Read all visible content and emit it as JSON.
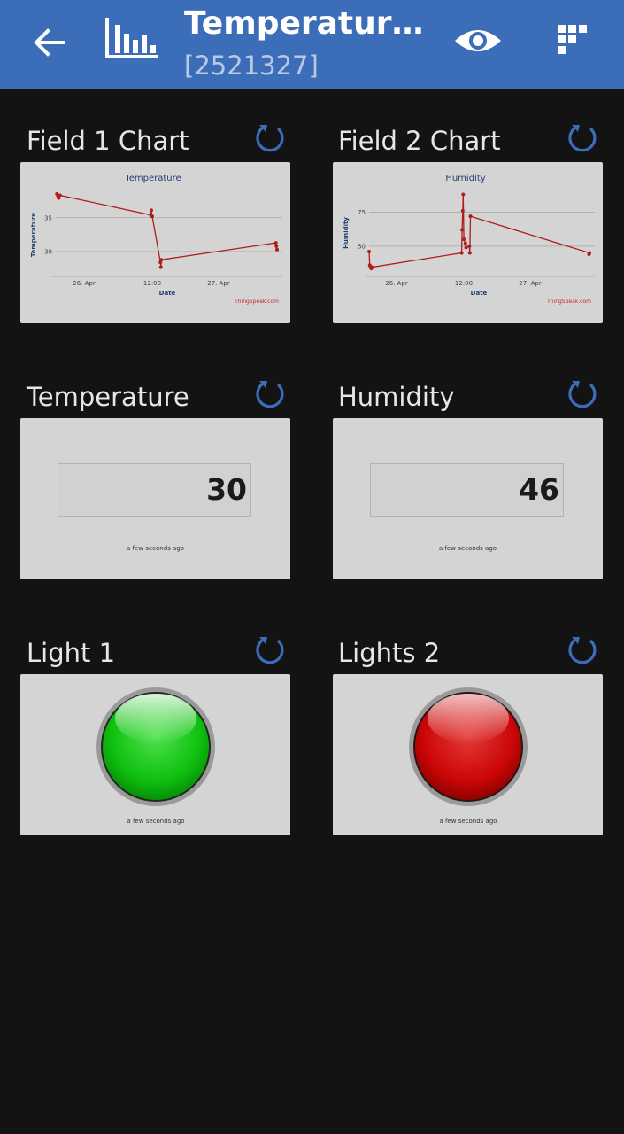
{
  "appbar": {
    "title": "Temperature…",
    "subtitle": "[2521327]",
    "back_icon": "arrow-left-icon",
    "charts_icon": "bar-chart-icon",
    "view_icon": "eye-icon",
    "menu_icon": "grid-icon",
    "background": "#3c6db8"
  },
  "cards": {
    "field1": {
      "title": "Field 1 Chart",
      "chart_data": {
        "type": "line",
        "title": "Temperature",
        "xlabel": "Date",
        "ylabel": "Temperature",
        "x_ticks": [
          "26. Apr",
          "12:00",
          "27. Apr"
        ],
        "y_ticks": [
          30,
          35
        ],
        "ylim": [
          27,
          38.5
        ],
        "series": [
          {
            "color": "#b01c1c",
            "points": [
              {
                "x": 0.005,
                "y": 38.5
              },
              {
                "x": 0.01,
                "y": 38.2
              },
              {
                "x": 0.013,
                "y": 37.9
              },
              {
                "x": 0.019,
                "y": 38.3
              },
              {
                "x": 0.43,
                "y": 35.4
              },
              {
                "x": 0.432,
                "y": 36.1
              },
              {
                "x": 0.436,
                "y": 35.2
              },
              {
                "x": 0.473,
                "y": 28.4
              },
              {
                "x": 0.475,
                "y": 27.7
              },
              {
                "x": 0.477,
                "y": 28.8
              },
              {
                "x": 0.995,
                "y": 31.3
              },
              {
                "x": 0.997,
                "y": 30.8
              },
              {
                "x": 1.0,
                "y": 30.3
              }
            ]
          }
        ],
        "watermark": "ThingSpeak.com",
        "grid": true
      },
      "refresh_icon": "refresh-icon"
    },
    "field2": {
      "title": "Field 2 Chart",
      "chart_data": {
        "type": "line",
        "title": "Humidity",
        "xlabel": "Date",
        "ylabel": "Humidity",
        "x_ticks": [
          "26. Apr",
          "12:00",
          "27. Apr"
        ],
        "y_ticks": [
          50,
          75
        ],
        "ylim": [
          31,
          89
        ],
        "series": [
          {
            "color": "#b01c1c",
            "points": [
              {
                "x": 0.0,
                "y": 46
              },
              {
                "x": 0.003,
                "y": 36
              },
              {
                "x": 0.006,
                "y": 35
              },
              {
                "x": 0.01,
                "y": 33.5
              },
              {
                "x": 0.013,
                "y": 34.5
              },
              {
                "x": 0.42,
                "y": 45
              },
              {
                "x": 0.422,
                "y": 62
              },
              {
                "x": 0.425,
                "y": 76
              },
              {
                "x": 0.427,
                "y": 88
              },
              {
                "x": 0.43,
                "y": 55
              },
              {
                "x": 0.437,
                "y": 52
              },
              {
                "x": 0.44,
                "y": 49
              },
              {
                "x": 0.455,
                "y": 50
              },
              {
                "x": 0.457,
                "y": 45
              },
              {
                "x": 0.46,
                "y": 72
              },
              {
                "x": 1.0,
                "y": 45
              },
              {
                "x": 0.998,
                "y": 44
              }
            ]
          }
        ],
        "watermark": "ThingSpeak.com",
        "grid": true
      },
      "refresh_icon": "refresh-icon"
    },
    "temperature": {
      "title": "Temperature",
      "value": "30",
      "updated": "a few seconds ago",
      "refresh_icon": "refresh-icon"
    },
    "humidity": {
      "title": "Humidity",
      "value": "46",
      "updated": "a few seconds ago",
      "refresh_icon": "refresh-icon"
    },
    "light1": {
      "title": "Light 1",
      "state": "on",
      "color": "#12c212",
      "updated": "a few seconds ago",
      "refresh_icon": "refresh-icon"
    },
    "light2": {
      "title": "Lights 2",
      "state": "off",
      "color": "#d21010",
      "updated": "a few seconds ago",
      "refresh_icon": "refresh-icon"
    }
  }
}
